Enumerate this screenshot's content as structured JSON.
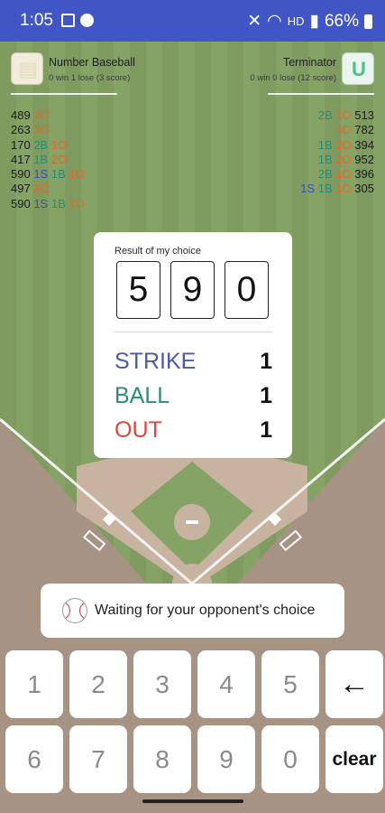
{
  "status_bar": {
    "time": "1:05",
    "network": "HD",
    "battery": "66%"
  },
  "players": {
    "me": {
      "name": "Number Baseball",
      "record": "0 win 1 lose (3 score)",
      "avatar_icon": "cream-block-icon"
    },
    "opponent": {
      "name": "Terminator",
      "record": "0 win 0 lose (12 score)",
      "avatar_icon": "green-u-icon"
    }
  },
  "history": {
    "left": [
      {
        "number": "489",
        "tokens": [
          {
            "t": "3O",
            "k": "O"
          }
        ]
      },
      {
        "number": "263",
        "tokens": [
          {
            "t": "3O",
            "k": "O"
          }
        ]
      },
      {
        "number": "170",
        "tokens": [
          {
            "t": "2B",
            "k": "B"
          },
          {
            "t": "1O",
            "k": "O"
          }
        ]
      },
      {
        "number": "417",
        "tokens": [
          {
            "t": "1B",
            "k": "B"
          },
          {
            "t": "2O",
            "k": "O"
          }
        ]
      },
      {
        "number": "590",
        "tokens": [
          {
            "t": "1S",
            "k": "S"
          },
          {
            "t": "1B",
            "k": "B"
          },
          {
            "t": "1O",
            "k": "O"
          }
        ]
      },
      {
        "number": "497",
        "tokens": [
          {
            "t": "3O",
            "k": "O"
          }
        ]
      },
      {
        "number": "590",
        "tokens": [
          {
            "t": "1S",
            "k": "S"
          },
          {
            "t": "1B",
            "k": "B"
          },
          {
            "t": "1O",
            "k": "O"
          }
        ]
      }
    ],
    "right": [
      {
        "number": "513",
        "tokens": [
          {
            "t": "2B",
            "k": "B"
          },
          {
            "t": "1O",
            "k": "O"
          }
        ]
      },
      {
        "number": "782",
        "tokens": [
          {
            "t": "3O",
            "k": "O"
          }
        ]
      },
      {
        "number": "394",
        "tokens": [
          {
            "t": "1B",
            "k": "B"
          },
          {
            "t": "2O",
            "k": "O"
          }
        ]
      },
      {
        "number": "952",
        "tokens": [
          {
            "t": "1B",
            "k": "B"
          },
          {
            "t": "2O",
            "k": "O"
          }
        ]
      },
      {
        "number": "396",
        "tokens": [
          {
            "t": "2B",
            "k": "B"
          },
          {
            "t": "1O",
            "k": "O"
          }
        ]
      },
      {
        "number": "305",
        "tokens": [
          {
            "t": "1S",
            "k": "S"
          },
          {
            "t": "1B",
            "k": "B"
          },
          {
            "t": "1O",
            "k": "O"
          }
        ]
      }
    ]
  },
  "result_card": {
    "title": "Result of my choice",
    "digits": [
      "5",
      "9",
      "0"
    ],
    "strike_label": "STRIKE",
    "strike_value": "1",
    "ball_label": "BALL",
    "ball_value": "1",
    "out_label": "OUT",
    "out_value": "1"
  },
  "waiting": {
    "icon": "baseball-icon",
    "text": "Waiting for your opponent's choice"
  },
  "keypad": {
    "rows": [
      [
        "1",
        "2",
        "3",
        "4",
        "5",
        "←"
      ],
      [
        "6",
        "7",
        "8",
        "9",
        "0",
        "clear"
      ]
    ]
  },
  "colors": {
    "strike": "#4a5aa8",
    "ball": "#2f8c73",
    "out": "#e0463e",
    "status_bar": "#3f56c4"
  }
}
